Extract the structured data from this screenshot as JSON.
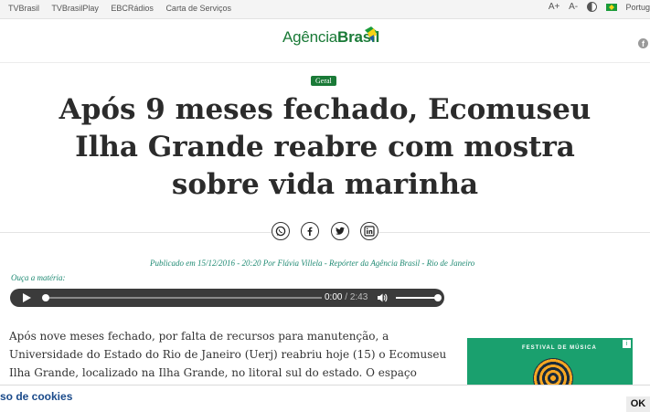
{
  "topbar": {
    "links": [
      "TVBrasil",
      "TVBrasilPlay",
      "EBCRádios",
      "Carta de Serviços"
    ],
    "font_increase": "A+",
    "font_decrease": "A-",
    "language": "Portug"
  },
  "logo": {
    "part1": "Agência",
    "part2": "Brasil"
  },
  "article": {
    "tag": "Geral",
    "headline": "Após 9 meses fechado, Ecomuseu Ilha Grande reabre com mostra sobre vida marinha",
    "byline": "Publicado em 15/12/2016 - 20:20 Por Flávia Villela - Repórter da Agência Brasil - Rio de Janeiro",
    "listen_label": "Ouça a matéria:",
    "body": "Após nove meses fechado, por falta de recursos para manutenção, a Universidade do Estado do Rio de Janeiro (Uerj) reabriu hoje (15) o Ecomuseu Ilha Grande, localizado na Ilha Grande, no litoral sul do estado. O espaço reúne as unidades Museu do Cárcere, Museu do Meio"
  },
  "share": {
    "icons": [
      "whatsapp-icon",
      "facebook-icon",
      "twitter-icon",
      "linkedin-icon"
    ]
  },
  "player": {
    "current_time": "0:00",
    "separator": "/",
    "duration": "2:43",
    "progress": 0,
    "volume": 1
  },
  "ad": {
    "text": "FESTIVAL DE MÚSICA"
  },
  "cookie": {
    "text": "so de cookies",
    "ok_label": "OK"
  },
  "colors": {
    "brand_green": "#1a7a37",
    "byline_teal": "#1f8a73",
    "cookie_link": "#1a4a8a"
  }
}
